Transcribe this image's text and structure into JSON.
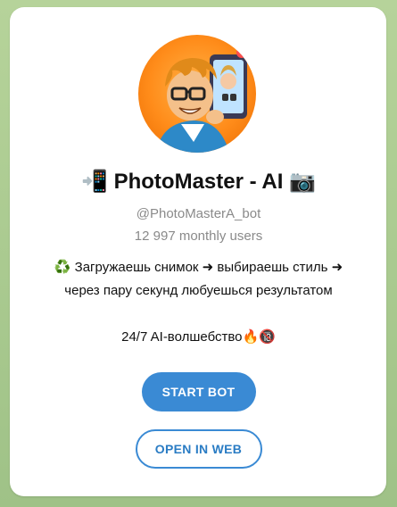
{
  "bot": {
    "avatar_icon": "cartoon-photographer-avatar",
    "title_emoji_left": "📲",
    "name": "PhotoMaster - AI",
    "title_emoji_right": "📷",
    "handle": "@PhotoMasterA_bot",
    "monthly_users": "12 997 monthly users",
    "description_line1": "♻️ Загружаешь снимок ➜ выбираешь стиль ➜",
    "description_line2": "через пару секунд любуешься результатом",
    "tagline": "24/7 AI-волшебство🔥🔞"
  },
  "actions": {
    "start_label": "START BOT",
    "open_web_label": "OPEN IN WEB"
  },
  "colors": {
    "background": "#a9c98e",
    "card": "#ffffff",
    "accent": "#3a8ad4",
    "muted_text": "#8a8a8a"
  }
}
